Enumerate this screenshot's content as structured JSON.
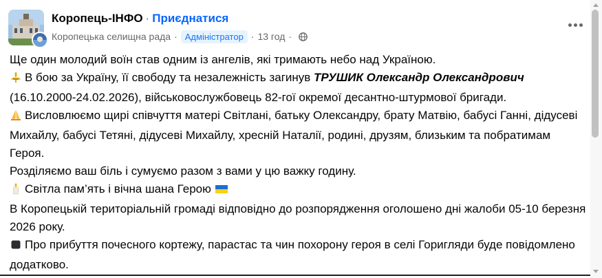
{
  "header": {
    "page_name": "Коропець-ІНФО",
    "separator": "·",
    "join_label": "Приєднатися",
    "author": "Коропецька селищна рада",
    "role_badge": "Адміністратор",
    "time": "13 год",
    "icons": {
      "avatar": "town-hall-image",
      "privacy": "globe-icon",
      "menu": "more-options-icon"
    }
  },
  "post": {
    "line1": "Ще один молодий воїн став одним із ангелів, які тримають небо над Україною.",
    "p2_pre": "В бою за Україну, її свободу та незалежність загинув ",
    "p2_name": "ТРУШИК Олександр Олександрович",
    "p2_post": "(16.10.2000-24.02.2026), військовослужбовець 82-гої окремої десантно-штурмової бригади.",
    "p3": "Висловлюємо щирі співчуття матері Світлані, батьку Олександру, брату Матвію, бабусі Ганні, дідусеві Михайлу, бабусі Тетяні, дідусеві Михайлу, хресній Наталії, родині, друзям, близьким та побратимам Героя.",
    "p4": "Розділяємо ваш біль і сумуємо разом з вами у цю важку годину.",
    "p5": "Світла пам’ять і вічна шана Герою",
    "p6": "В Коропецькій територіальній громаді відповідно до розпорядження оголошено дні жалоби 05-10 березня 2026 року.",
    "p7": "Про прибуття почесного кортежу, парастас та чин похорону героя в селі Горигляди буде повідомлено додатково.",
    "emoji": [
      "fleur-de-lis-icon",
      "praying-hands-icon",
      "candle-icon",
      "ukraine-flag-icon",
      "black-square-icon"
    ]
  },
  "colors": {
    "link": "#0866ff",
    "meta": "#65676b",
    "badge_bg": "#e7f3ff",
    "badge_fg": "#1877f2"
  }
}
